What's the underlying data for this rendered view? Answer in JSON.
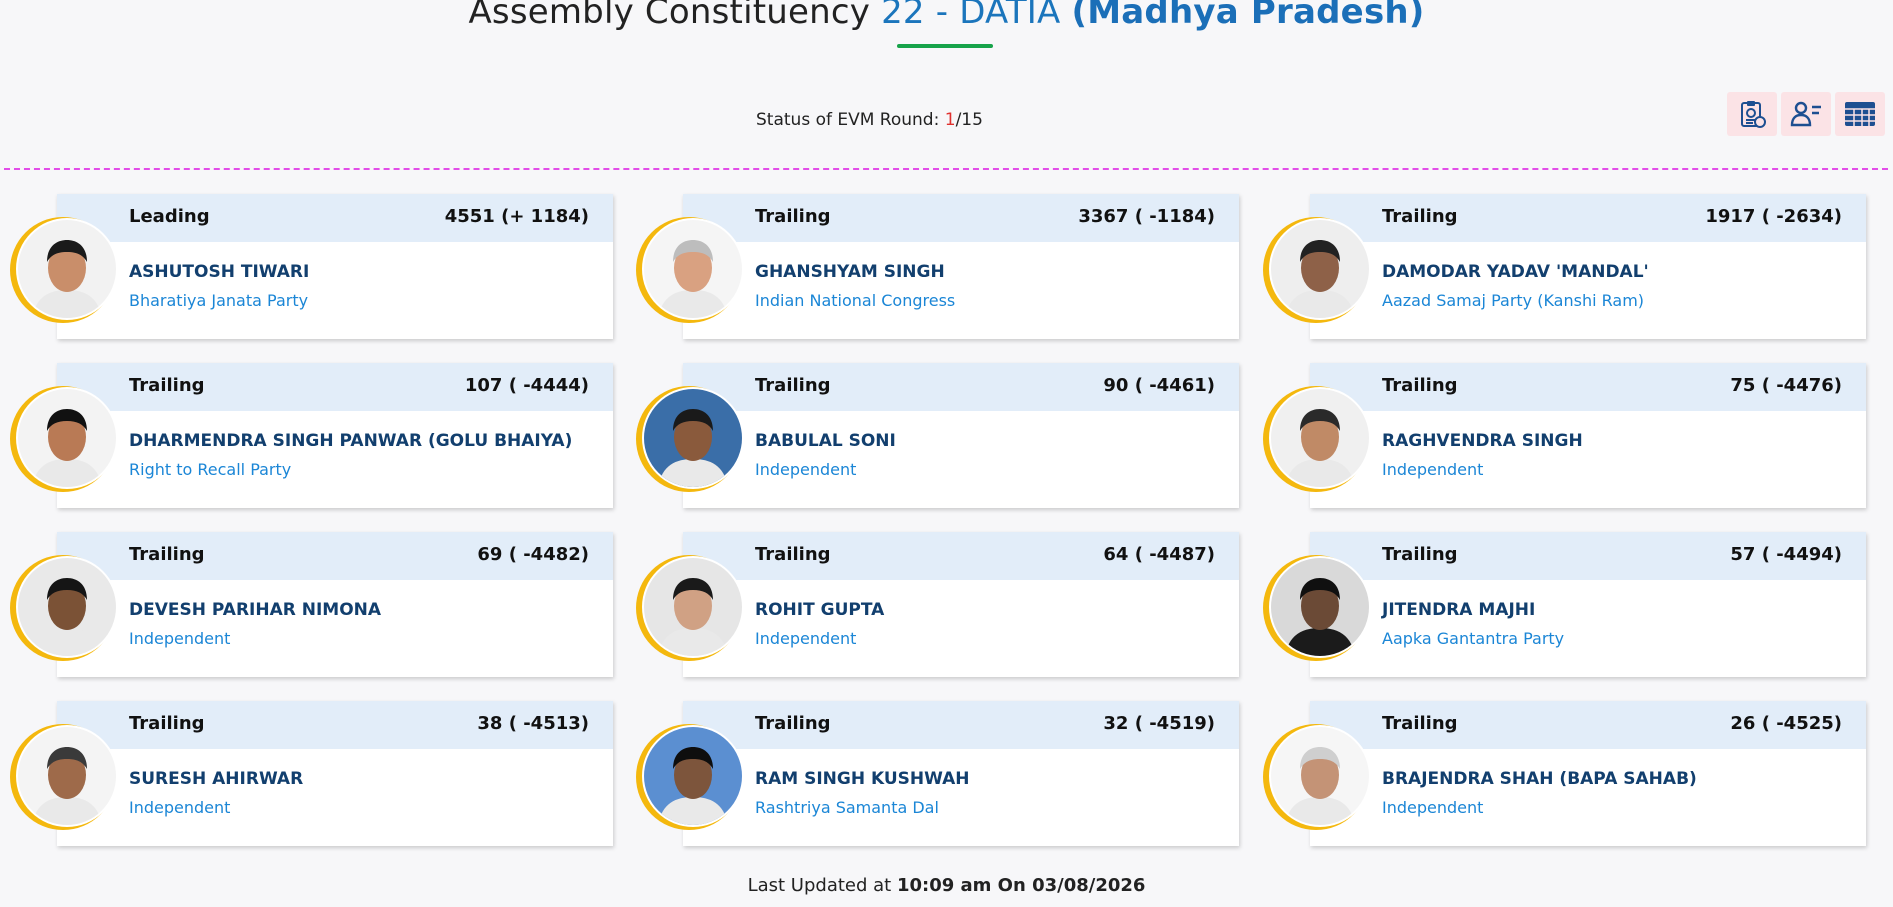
{
  "header": {
    "title_prefix": "Assembly Constituency",
    "ac_code": "22 - DATIA",
    "state": "(Madhya Pradesh)"
  },
  "status": {
    "label": "Status of EVM Round:",
    "current": "1",
    "sep": "/",
    "total": "15"
  },
  "toolbar": {
    "icons": [
      "clipboard-report-icon",
      "candidate-list-icon",
      "table-grid-icon"
    ]
  },
  "candidates": [
    {
      "status": "Leading",
      "votes": "4551 (+ 1184)",
      "name": "ASHUTOSH TIWARI",
      "party": "Bharatiya Janata Party"
    },
    {
      "status": "Trailing",
      "votes": "3367 ( -1184)",
      "name": "GHANSHYAM SINGH",
      "party": "Indian National Congress"
    },
    {
      "status": "Trailing",
      "votes": "1917 ( -2634)",
      "name": "DAMODAR YADAV 'MANDAL'",
      "party": "Aazad Samaj Party (Kanshi Ram)"
    },
    {
      "status": "Trailing",
      "votes": "107 ( -4444)",
      "name": "DHARMENDRA SINGH PANWAR (GOLU BHAIYA)",
      "party": "Right to Recall Party"
    },
    {
      "status": "Trailing",
      "votes": "90 ( -4461)",
      "name": "BABULAL SONI",
      "party": "Independent"
    },
    {
      "status": "Trailing",
      "votes": "75 ( -4476)",
      "name": "RAGHVENDRA SINGH",
      "party": "Independent"
    },
    {
      "status": "Trailing",
      "votes": "69 ( -4482)",
      "name": "DEVESH PARIHAR NIMONA",
      "party": "Independent"
    },
    {
      "status": "Trailing",
      "votes": "64 ( -4487)",
      "name": "ROHIT GUPTA",
      "party": "Independent"
    },
    {
      "status": "Trailing",
      "votes": "57 ( -4494)",
      "name": "JITENDRA MAJHI",
      "party": "Aapka Gantantra Party"
    },
    {
      "status": "Trailing",
      "votes": "38 ( -4513)",
      "name": "SURESH AHIRWAR",
      "party": "Independent"
    },
    {
      "status": "Trailing",
      "votes": "32 ( -4519)",
      "name": "RAM SINGH KUSHWAH",
      "party": "Rashtriya Samanta Dal"
    },
    {
      "status": "Trailing",
      "votes": "26 ( -4525)",
      "name": "BRAJENDRA SHAH (BAPA SAHAB)",
      "party": "Independent"
    }
  ],
  "footer": {
    "label": "Last Updated at",
    "time": "10:09 am On 03/08/2026"
  },
  "colors": {
    "accent_blue": "#1b75bc",
    "ring_gold": "#f4b80e",
    "card_header": "#e2edf9",
    "divider": "#e24de8",
    "underline": "#17a34a"
  }
}
